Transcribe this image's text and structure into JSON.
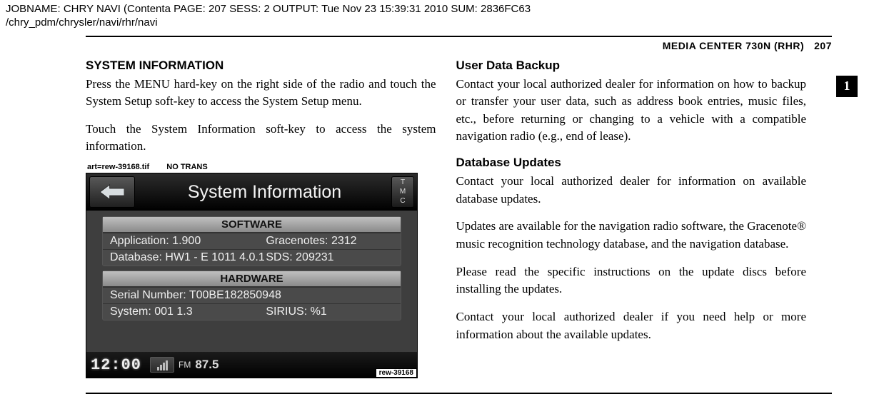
{
  "job_header": {
    "line1": "JOBNAME: CHRY NAVI (Contenta    PAGE: 207   SESS: 2   OUTPUT: Tue Nov 23 15:39:31 2010   SUM: 2836FC63",
    "line2": "/chry_pdm/chrysler/navi/rhr/navi"
  },
  "header": {
    "title": "MEDIA CENTER 730N (RHR)",
    "page_number": "207"
  },
  "side_tab": "1",
  "left_col": {
    "h1": "SYSTEM INFORMATION",
    "p1": "Press the MENU hard-key on the right side of the radio and touch the System Setup soft-key to access the System Setup menu.",
    "p2": "Touch the System Information soft-key to access the system information.",
    "img_caption_art": "art=rew-39168.tif",
    "img_caption_trans": "NO TRANS"
  },
  "right_col": {
    "h1": "User Data Backup",
    "p1": "Contact your local authorized dealer for information on how to backup or transfer your user data, such as address book entries, music files, etc., before returning or changing to a vehicle with a compatible navigation radio (e.g., end of lease).",
    "h2": "Database Updates",
    "p2": "Contact your local authorized dealer for information on available database updates.",
    "p3": "Updates are available for the navigation radio software, the Gracenote® music recognition technology database, and the navigation database.",
    "p4": "Please read the specific instructions on the update discs before installing the updates.",
    "p5": "Contact your local authorized dealer if you need help or more information about the available updates."
  },
  "screenshot": {
    "title": "System Information",
    "tmc": "TMC",
    "software": {
      "header": "SOFTWARE",
      "application_label": "Application:",
      "application_value": "1.900",
      "gracenotes_label": "Gracenotes:",
      "gracenotes_value": "2312",
      "database_label": "Database:",
      "database_value": "HW1 - E 1011 4.0.1",
      "sds_label": "SDS:",
      "sds_value": "209231"
    },
    "hardware": {
      "header": "HARDWARE",
      "serial_label": "Serial Number:",
      "serial_value": "T00BE182850948",
      "system_label": "System:",
      "system_value": "001 1.3",
      "sirius_label": "SIRIUS:",
      "sirius_value": "%1"
    },
    "status": {
      "clock": "12:00",
      "band": "FM",
      "freq": "87.5"
    },
    "tag": "rew-39168"
  }
}
